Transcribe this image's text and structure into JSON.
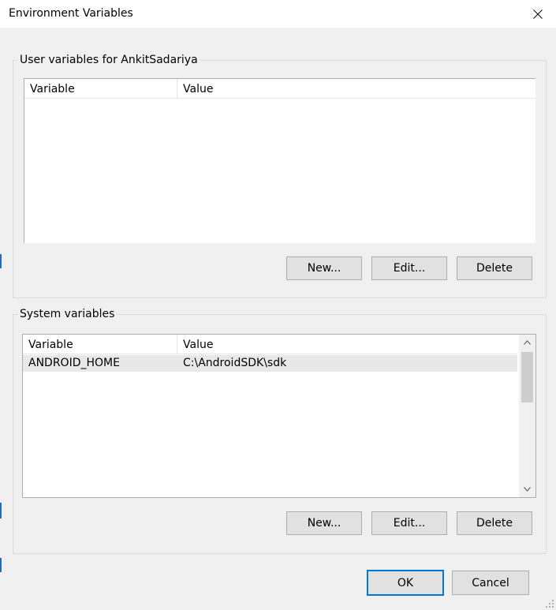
{
  "window": {
    "title": "Environment Variables",
    "close_icon": "close-icon"
  },
  "user_section": {
    "label": "User variables for AnkitSadariya",
    "columns": [
      "Variable",
      "Value"
    ],
    "rows": [],
    "buttons": {
      "new": "New...",
      "edit": "Edit...",
      "delete": "Delete"
    }
  },
  "system_section": {
    "label": "System variables",
    "columns": [
      "Variable",
      "Value"
    ],
    "rows": [
      {
        "variable": "ANDROID_HOME",
        "value": "C:\\AndroidSDK\\sdk"
      }
    ],
    "buttons": {
      "new": "New...",
      "edit": "Edit...",
      "delete": "Delete"
    }
  },
  "footer": {
    "ok": "OK",
    "cancel": "Cancel"
  },
  "colors": {
    "accent": "#0078d7",
    "selection": "#e8e8e8"
  }
}
